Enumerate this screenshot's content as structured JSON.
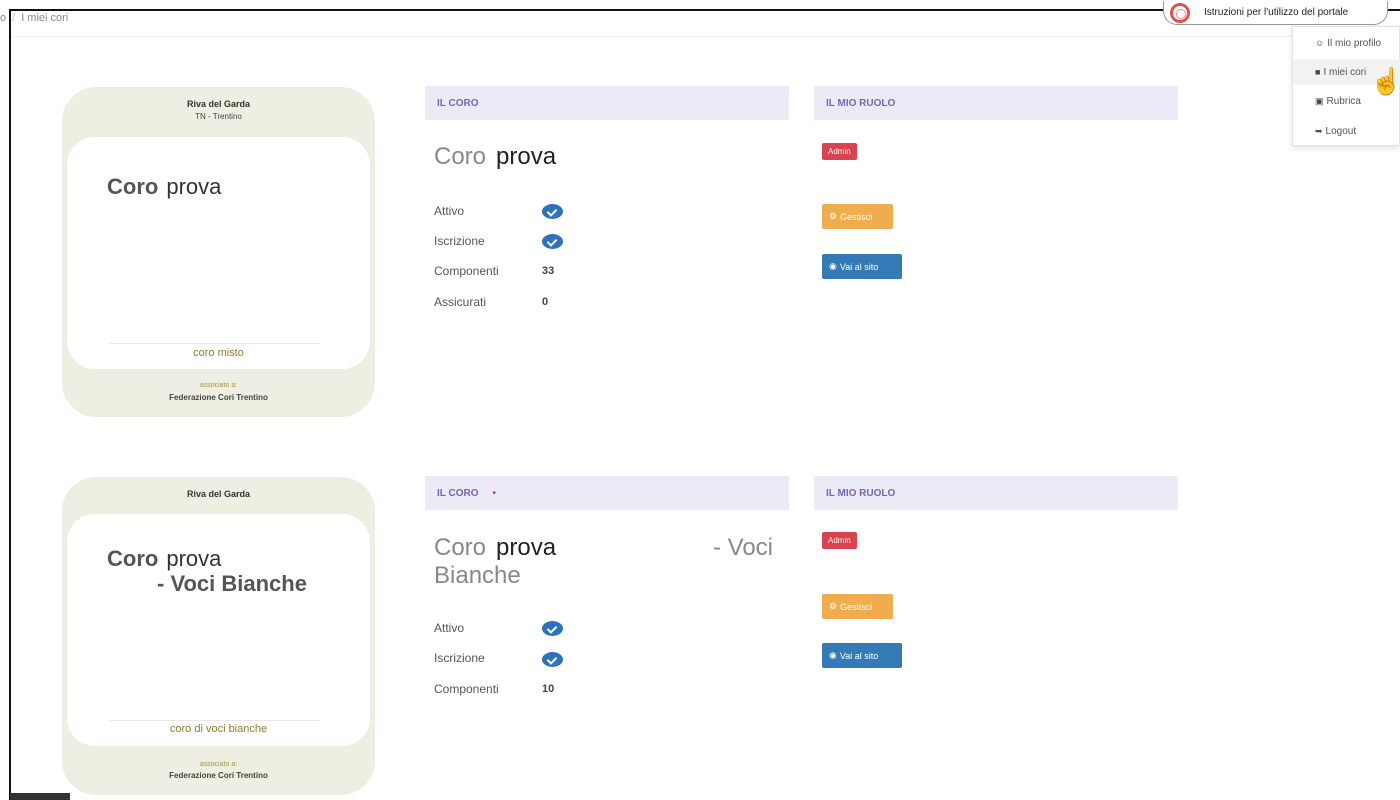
{
  "breadcrumb": {
    "prev": "o",
    "current": "I miei cori"
  },
  "help": {
    "label": "Istruzioni per l'utilizzo del portale"
  },
  "user_menu": {
    "items": [
      {
        "icon": "user-icon",
        "glyph": "☺",
        "label": "Il mio profilo"
      },
      {
        "icon": "book-icon",
        "glyph": "■",
        "label": "I miei cori"
      },
      {
        "icon": "address-book-icon",
        "glyph": "▣",
        "label": "Rubrica"
      },
      {
        "icon": "logout-icon",
        "glyph": "➥",
        "label": "Logout"
      }
    ]
  },
  "choirs": [
    {
      "card": {
        "city": "Riva del Garda",
        "province": "TN - Trentino",
        "name_prefix": "Coro",
        "name": "prova",
        "name_suffix": "",
        "type": "coro misto",
        "assoc_label": "associato a:",
        "assoc": "Federazione Cori Trentino"
      },
      "panel": {
        "header": "IL CORO",
        "title_prefix": "Coro",
        "title_name": "prova",
        "title_suffix": "",
        "stats": [
          {
            "label": "Attivo",
            "kind": "check"
          },
          {
            "label": "Iscrizione",
            "kind": "check"
          },
          {
            "label": "Componenti",
            "kind": "value",
            "value": "33"
          },
          {
            "label": "Assicurati",
            "kind": "value",
            "value": "0"
          }
        ]
      },
      "role": {
        "header": "IL MIO RUOLO",
        "badge": "Admin",
        "manage_label": "Gestisci",
        "site_label": "Vai al sito"
      }
    },
    {
      "card": {
        "city": "Riva del Garda",
        "province": "",
        "name_prefix": "Coro",
        "name": "prova",
        "name_suffix": "- Voci Bianche",
        "type": "coro di voci bianche",
        "assoc_label": "associato a:",
        "assoc": "Federazione Cori Trentino"
      },
      "panel": {
        "header": "IL CORO",
        "header_mark": "•",
        "title_prefix": "Coro",
        "title_name": "prova",
        "title_suffix": "- Voci",
        "title_line2": "Bianche",
        "stats": [
          {
            "label": "Attivo",
            "kind": "check"
          },
          {
            "label": "Iscrizione",
            "kind": "check"
          },
          {
            "label": "Componenti",
            "kind": "value",
            "value": "10"
          }
        ]
      },
      "role": {
        "header": "IL MIO RUOLO",
        "badge": "Admin",
        "manage_label": "Gestisci",
        "site_label": "Vai al sito"
      }
    }
  ],
  "colors": {
    "card_bg": "#efeee3",
    "panel_header_bg": "#eceaf7",
    "panel_header_text": "#7865b8",
    "admin_badge": "#d9434e",
    "manage_button": "#f0ad4e",
    "site_button": "#337ab7",
    "check": "#2b73c0"
  }
}
